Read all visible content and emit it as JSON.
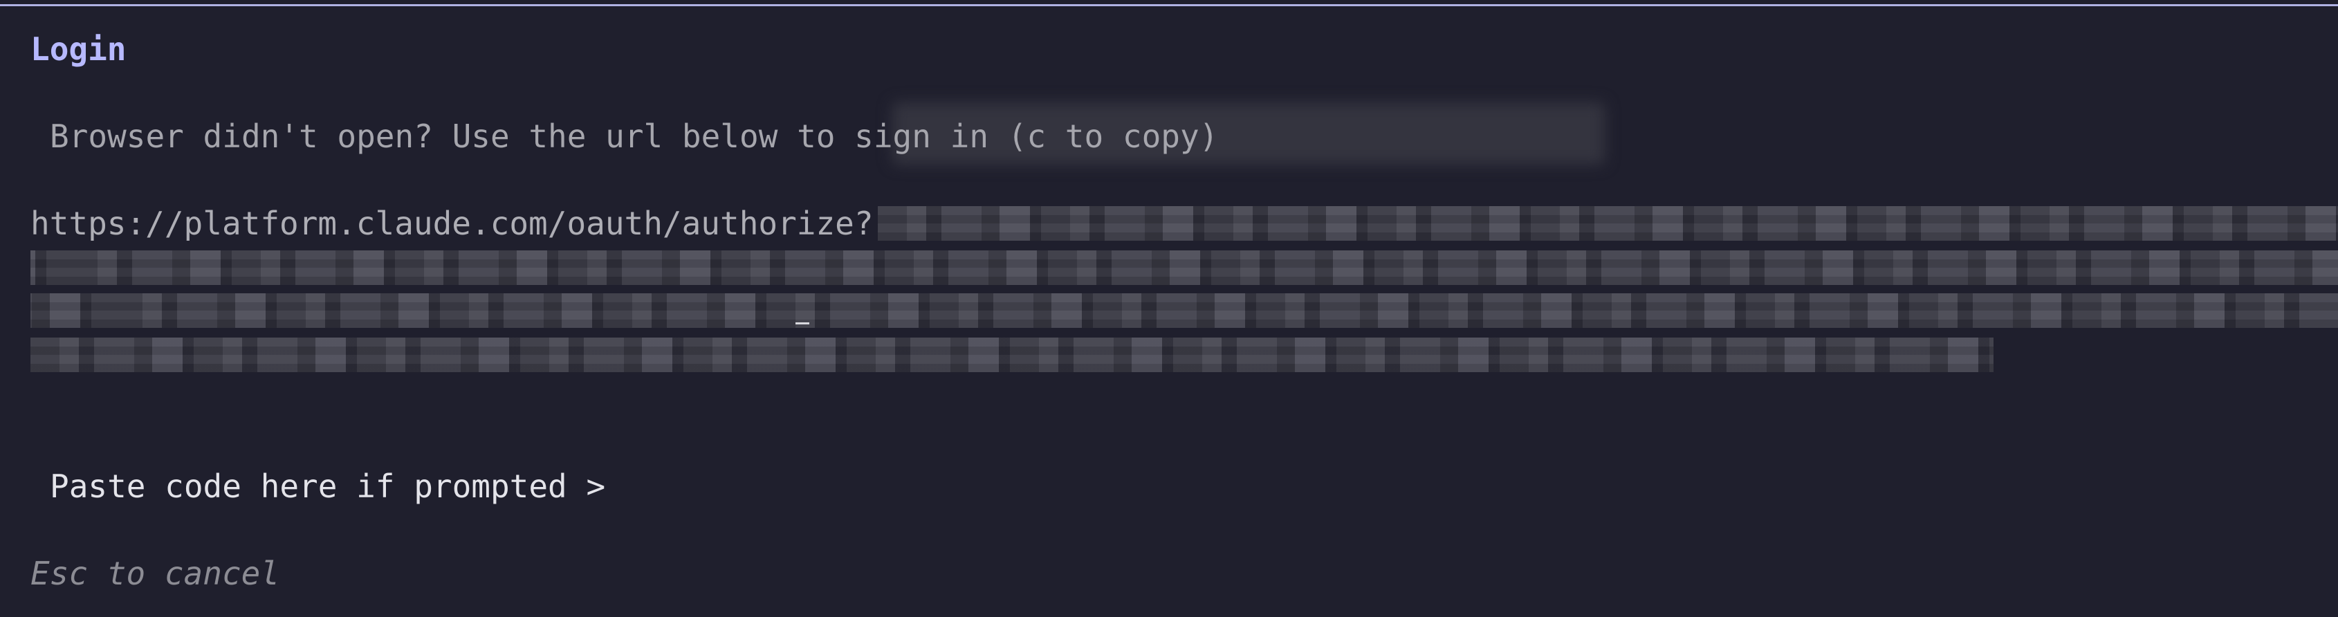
{
  "login": {
    "title": "Login",
    "browser_hint": "Browser didn't open? Use the url below to sign in (c to copy)",
    "url_prefix": "https://platform.claude.com/oauth/authorize?",
    "paste_prompt": "Paste code here if prompted >",
    "cancel_hint": "Esc to cancel"
  },
  "colors": {
    "background": "#1f1f2d",
    "accent": "#b7b9ff",
    "top_rule": "#b0b2e4"
  }
}
